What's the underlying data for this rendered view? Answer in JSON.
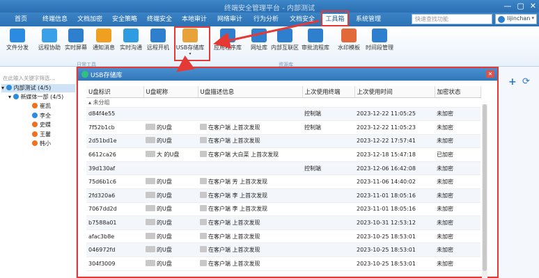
{
  "window": {
    "title": "终端安全管理平台 - 内部测试",
    "controls": [
      "—",
      "▢",
      "✕"
    ]
  },
  "nav": {
    "tabs": [
      "首页",
      "终端信息",
      "文档加密",
      "安全策略",
      "终端安全",
      "本地审计",
      "网络审计",
      "行为分析",
      "文档安全",
      "工具箱",
      "系统管理"
    ],
    "active_index": 9,
    "search_placeholder": "快速查找功能",
    "user": "lijinchan"
  },
  "toolbar": {
    "tools": [
      {
        "label": "文件分发",
        "icon": "paper-plane-icon",
        "color": "#2a8be0"
      },
      {
        "label": "远程协助",
        "icon": "remote-assist-icon",
        "color": "#3aa0e8"
      },
      {
        "label": "实时屏幕",
        "icon": "screen-icon",
        "color": "#2f7fcf"
      },
      {
        "label": "通知消息",
        "icon": "bell-icon",
        "color": "#f0a020"
      },
      {
        "label": "实时沟通",
        "icon": "chat-icon",
        "color": "#2f9be0"
      },
      {
        "label": "远程开机",
        "icon": "power-icon",
        "color": "#2f7fcf"
      },
      {
        "label": "USB存储库",
        "icon": "usb-icon",
        "color": "#e8a23a"
      },
      {
        "label": "应用程序库",
        "icon": "app-library-icon",
        "color": "#2f7fcf"
      },
      {
        "label": "网址库",
        "icon": "web-library-icon",
        "color": "#2f7fcf"
      },
      {
        "label": "内部互联区",
        "icon": "network-icon",
        "color": "#2f7fcf"
      },
      {
        "label": "审批流程库",
        "icon": "approval-icon",
        "color": "#2f7fcf"
      },
      {
        "label": "水印模板",
        "icon": "watermark-icon",
        "color": "#e26a3a"
      },
      {
        "label": "时间段管理",
        "icon": "clock-gear-icon",
        "color": "#2f7fcf"
      }
    ],
    "groups": [
      "日常工具",
      "资源库"
    ]
  },
  "tree": {
    "search_placeholder": "在此输入关键字筛选...",
    "root": "内部测试 (4/5)",
    "dept": "新媒体一部 (4/5)",
    "users": [
      {
        "name": "崔凯",
        "color": "#f07020"
      },
      {
        "name": "李全",
        "color": "#2a8be0"
      },
      {
        "name": "史蝶",
        "color": "#f07020"
      },
      {
        "name": "王馨",
        "color": "#f07020"
      },
      {
        "name": "韩小",
        "color": "#f07020"
      }
    ]
  },
  "dialog": {
    "title": "USB存储库",
    "columns": [
      "U盘标识",
      "U盘昵称",
      "U盘描述信息",
      "上次使用终端",
      "上次使用时间",
      "加密状态"
    ],
    "group_label": "未分组",
    "rows": [
      {
        "id": "d84f4e55",
        "nick": "",
        "desc": "",
        "term": "控制端",
        "time": "2023-12-22 11:05:25",
        "enc": "未加密"
      },
      {
        "id": "7f52b1cb",
        "nick": "的U盘",
        "desc": "在客户端 上首次发现",
        "term": "控制端",
        "time": "2023-12-22 11:05:23",
        "enc": "未加密"
      },
      {
        "id": "2d51bd1e",
        "nick": "的U盘",
        "desc": "在客户端 上首次发现",
        "term": "",
        "time": "2023-12-22 17:57:41",
        "enc": "未加密"
      },
      {
        "id": "6612ca26",
        "nick": "大 的U盘",
        "desc": "在客户端 大白菜 上首次发现",
        "term": "",
        "time": "2023-12-18 15:47:18",
        "enc": "已加密"
      },
      {
        "id": "39d130af",
        "nick": "",
        "desc": "",
        "term": "控制端",
        "time": "2023-12-06 16:42:08",
        "enc": "未加密"
      },
      {
        "id": "75d6b1c6",
        "nick": "的U盘",
        "desc": "在客户端 芳 上首次发现",
        "term": "",
        "time": "2023-11-06 14:40:02",
        "enc": "未加密"
      },
      {
        "id": "2fd320a6",
        "nick": "的U盘",
        "desc": "在客户端 李 上首次发现",
        "term": "",
        "time": "2023-11-01 18:05:16",
        "enc": "未加密"
      },
      {
        "id": "7067dd2d",
        "nick": "的U盘",
        "desc": "在客户端 李 上首次发现",
        "term": "",
        "time": "2023-11-01 18:05:16",
        "enc": "未加密"
      },
      {
        "id": "b7588a01",
        "nick": "的U盘",
        "desc": "在客户端 上首次发现",
        "term": "",
        "time": "2023-10-31 12:53:12",
        "enc": "未加密"
      },
      {
        "id": "afac3b8e",
        "nick": "的U盘",
        "desc": "在客户端 上首次发现",
        "term": "",
        "time": "2023-10-25 18:53:01",
        "enc": "未加密"
      },
      {
        "id": "046972fd",
        "nick": "的U盘",
        "desc": "在客户端 上首次发现",
        "term": "",
        "time": "2023-10-25 18:53:01",
        "enc": "未加密"
      },
      {
        "id": "304f3009",
        "nick": "的U盘",
        "desc": "在客户端 上首次发现",
        "term": "",
        "time": "2023-10-25 18:53:01",
        "enc": "未加密"
      }
    ]
  },
  "colors": {
    "accent": "#2f7fcf",
    "highlight": "#e53935",
    "delete": "#ff6a13"
  }
}
